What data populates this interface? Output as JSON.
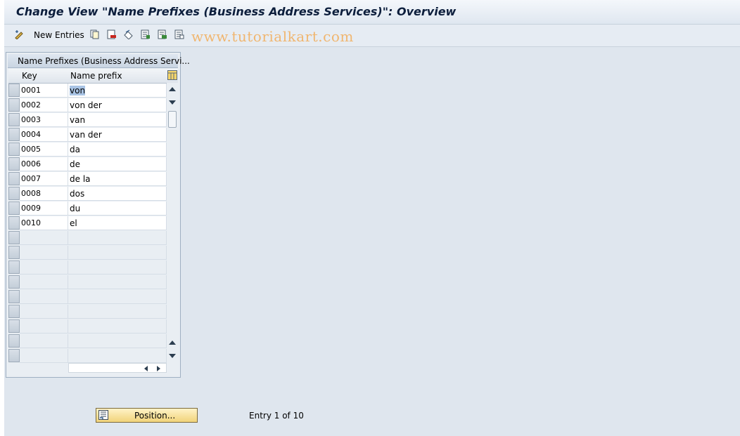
{
  "window": {
    "title": "Change View \"Name Prefixes (Business Address Services)\": Overview"
  },
  "toolbar": {
    "new_entries_label": "New Entries",
    "icons": [
      "change-display-icon",
      "copy-icon",
      "delete-icon",
      "undo-change-icon",
      "select-all-icon",
      "select-block-icon",
      "deselect-all-icon"
    ]
  },
  "watermark": "www.tutorialkart.com",
  "table": {
    "title": "Name Prefixes (Business Address Servi...",
    "columns": [
      "Key",
      "Name prefix"
    ],
    "rows": [
      {
        "key": "0001",
        "prefix": "von"
      },
      {
        "key": "0002",
        "prefix": "von der"
      },
      {
        "key": "0003",
        "prefix": "van"
      },
      {
        "key": "0004",
        "prefix": "van der"
      },
      {
        "key": "0005",
        "prefix": "da"
      },
      {
        "key": "0006",
        "prefix": "de"
      },
      {
        "key": "0007",
        "prefix": "de la"
      },
      {
        "key": "0008",
        "prefix": "dos"
      },
      {
        "key": "0009",
        "prefix": "du"
      },
      {
        "key": "0010",
        "prefix": "el"
      }
    ],
    "empty_rows": 9,
    "selected_row": 0
  },
  "footer": {
    "position_button": "Position...",
    "entry_info": "Entry 1 of 10"
  },
  "colors": {
    "title_text": "#0c1e3c",
    "watermark": "#f0b670",
    "button_fill": "#f1d37a"
  }
}
